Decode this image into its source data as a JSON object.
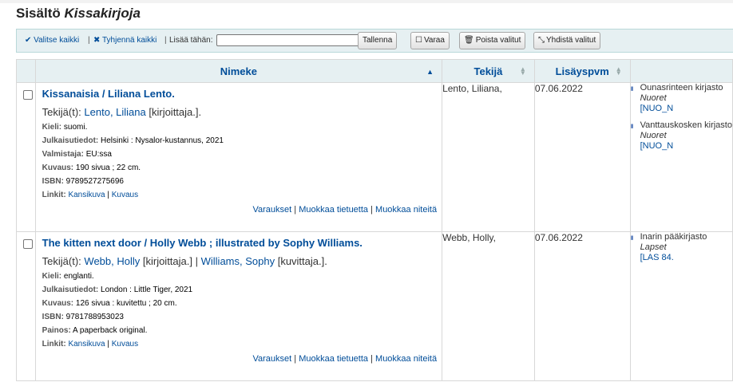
{
  "page": {
    "title_prefix": "Sisältö",
    "title_list": "Kissakirjoja"
  },
  "toolbar": {
    "select_all": "Valitse kaikki",
    "clear_all": "Tyhjennä kaikki",
    "add_to_label": "Lisää tähän:",
    "add_to_value": "",
    "save": "Tallenna",
    "hold": "Varaa",
    "remove_selected": "Poista valitut",
    "merge_selected": "Yhdistä valitut"
  },
  "columns": {
    "title": "Nimeke",
    "author": "Tekijä",
    "added": "Lisäyspvm"
  },
  "records": [
    {
      "title": "Kissanaisia / Liliana Lento.",
      "authors_label": "Tekijä(t): ",
      "author1": "Lento, Liliana",
      "author1_role": " [kirjoittaja.].",
      "fields": [
        {
          "k": "Kieli:",
          "v": " suomi."
        },
        {
          "k": "Julkaisutiedot:",
          "v": " Helsinki : Nysalor-kustannus, 2021"
        },
        {
          "k": "Valmistaja:",
          "v": " EU:ssa"
        },
        {
          "k": "Kuvaus:",
          "v": " 190 sivua ; 22 cm."
        },
        {
          "k": "ISBN:",
          "v": " 9789527275696"
        }
      ],
      "links_label": "Linkit:",
      "link1": "Kansikuva",
      "link2": "Kuvaus",
      "act_holds": "Varaukset",
      "act_edit_record": "Muokkaa tietuetta",
      "act_edit_items": "Muokkaa niteitä",
      "author_col": "Lento, Liliana,",
      "date_added": "07.06.2022",
      "items": [
        {
          "loc": "Ounasrinteen kirjasto",
          "coll": "Nuoret",
          "call": "[NUO_N"
        },
        {
          "loc": "Vanttauskosken kirjasto",
          "coll": "Nuoret",
          "call": "[NUO_N"
        }
      ]
    },
    {
      "title": "The kitten next door / Holly Webb ; illustrated by Sophy Williams.",
      "authors_label": "Tekijä(t): ",
      "author1": "Webb, Holly",
      "author1_role": " [kirjoittaja.]",
      "author2": "Williams, Sophy",
      "author2_role": " [kuvittaja.].",
      "fields": [
        {
          "k": "Kieli:",
          "v": " englanti."
        },
        {
          "k": "Julkaisutiedot:",
          "v": " London : Little Tiger, 2021"
        },
        {
          "k": "Kuvaus:",
          "v": " 126 sivua : kuvitettu ; 20 cm."
        },
        {
          "k": "ISBN:",
          "v": " 9781788953023"
        },
        {
          "k": "Painos:",
          "v": " A paperback original."
        }
      ],
      "links_label": "Linkit:",
      "link1": "Kansikuva",
      "link2": "Kuvaus",
      "act_holds": "Varaukset",
      "act_edit_record": "Muokkaa tietuetta",
      "act_edit_items": "Muokkaa niteitä",
      "author_col": "Webb, Holly,",
      "date_added": "07.06.2022",
      "items": [
        {
          "loc": "Inarin pääkirjasto",
          "coll": "Lapset",
          "call": "[LAS 84."
        }
      ]
    }
  ]
}
